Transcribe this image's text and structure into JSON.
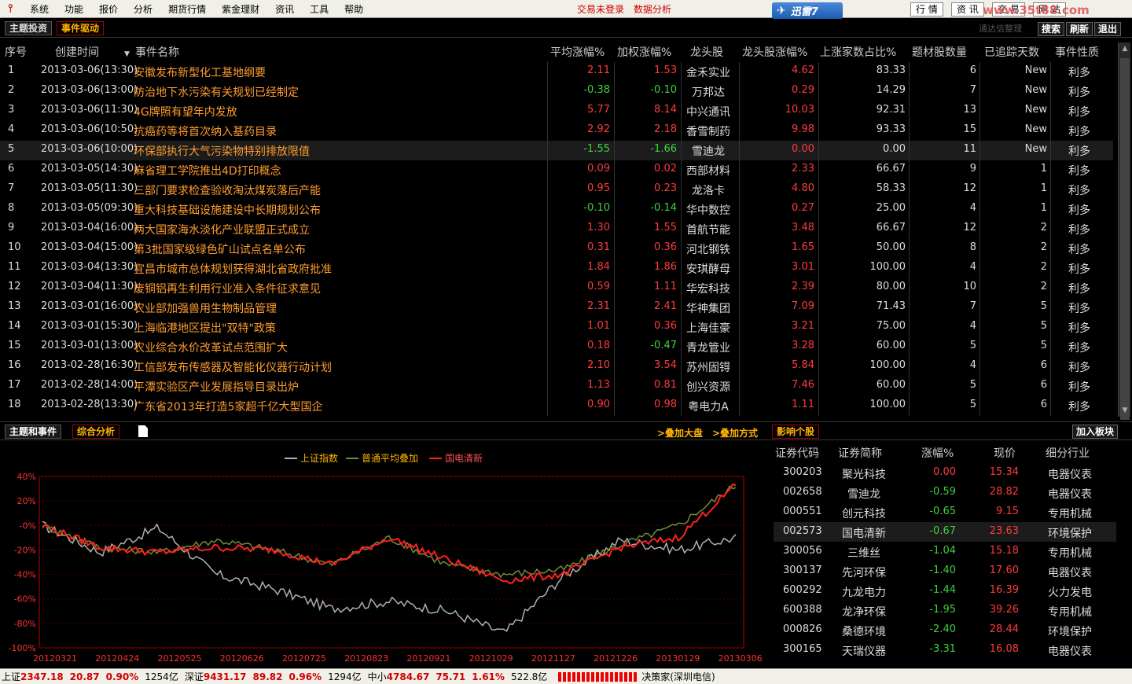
{
  "menu": {
    "items": [
      "系统",
      "功能",
      "报价",
      "分析",
      "期货行情",
      "紫金理财",
      "资讯",
      "工具",
      "帮助"
    ],
    "trade_status": "交易未登录",
    "data_analysis": "数据分析",
    "xunlei": "迅雷7",
    "right_tabs": [
      "行 情",
      "资 讯",
      "交 易",
      "网 站"
    ],
    "watermark": "www.35t88.com",
    "watermark_sub": "通达信整理"
  },
  "toolbar1": {
    "tab_theme": "主题投资",
    "tab_event": "事件驱动",
    "search": "搜索",
    "refresh": "刷新",
    "exit": "退出"
  },
  "events": {
    "headers": [
      "序号",
      "创建时间",
      "事件名称",
      "平均涨幅%",
      "加权涨幅%",
      "龙头股",
      "龙头股涨幅%",
      "上涨家数占比%",
      "题材股数量",
      "已追踪天数",
      "事件性质"
    ],
    "sort_indicator": "▼",
    "rows": [
      {
        "idx": "1",
        "time": "2013-03-06(13:30)",
        "name": "安徽发布新型化工基地纲要",
        "avg": "2.11",
        "wt": "1.53",
        "lead": "金禾实业",
        "leadchg": "4.62",
        "uppct": "83.33",
        "cnt": "6",
        "days": "New",
        "nature": "利多"
      },
      {
        "idx": "2",
        "time": "2013-03-06(13:00)",
        "name": "防治地下水污染有关规划已经制定",
        "avg": "-0.38",
        "wt": "-0.10",
        "lead": "万邦达",
        "leadchg": "0.29",
        "uppct": "14.29",
        "cnt": "7",
        "days": "New",
        "nature": "利多"
      },
      {
        "idx": "3",
        "time": "2013-03-06(11:30)",
        "name": "4G牌照有望年内发放",
        "avg": "5.77",
        "wt": "8.14",
        "lead": "中兴通讯",
        "leadchg": "10.03",
        "uppct": "92.31",
        "cnt": "13",
        "days": "New",
        "nature": "利多"
      },
      {
        "idx": "4",
        "time": "2013-03-06(10:50)",
        "name": "抗癌药等将首次纳入基药目录",
        "avg": "2.92",
        "wt": "2.18",
        "lead": "香雪制药",
        "leadchg": "9.98",
        "uppct": "93.33",
        "cnt": "15",
        "days": "New",
        "nature": "利多"
      },
      {
        "idx": "5",
        "time": "2013-03-06(10:00)",
        "name": "环保部执行大气污染物特别排放限值",
        "avg": "-1.55",
        "wt": "-1.66",
        "lead": "雪迪龙",
        "leadchg": "0.00",
        "uppct": "0.00",
        "cnt": "11",
        "days": "New",
        "nature": "利多"
      },
      {
        "idx": "6",
        "time": "2013-03-05(14:30)",
        "name": "麻省理工学院推出4D打印概念",
        "avg": "0.09",
        "wt": "0.02",
        "lead": "西部材料",
        "leadchg": "2.33",
        "uppct": "66.67",
        "cnt": "9",
        "days": "1",
        "nature": "利多"
      },
      {
        "idx": "7",
        "time": "2013-03-05(11:30)",
        "name": "三部门要求检查验收淘汰煤炭落后产能",
        "avg": "0.95",
        "wt": "0.23",
        "lead": "龙洛卡",
        "leadchg": "4.80",
        "uppct": "58.33",
        "cnt": "12",
        "days": "1",
        "nature": "利多"
      },
      {
        "idx": "8",
        "time": "2013-03-05(09:30)",
        "name": "重大科技基础设施建设中长期规划公布",
        "avg": "-0.10",
        "wt": "-0.14",
        "lead": "华中数控",
        "leadchg": "0.27",
        "uppct": "25.00",
        "cnt": "4",
        "days": "1",
        "nature": "利多"
      },
      {
        "idx": "9",
        "time": "2013-03-04(16:00)",
        "name": "两大国家海水淡化产业联盟正式成立",
        "avg": "1.30",
        "wt": "1.55",
        "lead": "首航节能",
        "leadchg": "3.48",
        "uppct": "66.67",
        "cnt": "12",
        "days": "2",
        "nature": "利多"
      },
      {
        "idx": "10",
        "time": "2013-03-04(15:00)",
        "name": "第3批国家级绿色矿山试点名单公布",
        "avg": "0.31",
        "wt": "0.36",
        "lead": "河北钢铁",
        "leadchg": "1.65",
        "uppct": "50.00",
        "cnt": "8",
        "days": "2",
        "nature": "利多"
      },
      {
        "idx": "11",
        "time": "2013-03-04(13:30)",
        "name": "宜昌市城市总体规划获得湖北省政府批准",
        "avg": "1.84",
        "wt": "1.86",
        "lead": "安琪酵母",
        "leadchg": "3.01",
        "uppct": "100.00",
        "cnt": "4",
        "days": "2",
        "nature": "利多"
      },
      {
        "idx": "12",
        "time": "2013-03-04(11:30)",
        "name": "废铜铝再生利用行业准入条件征求意见",
        "avg": "0.59",
        "wt": "1.11",
        "lead": "华宏科技",
        "leadchg": "2.39",
        "uppct": "80.00",
        "cnt": "10",
        "days": "2",
        "nature": "利多"
      },
      {
        "idx": "13",
        "time": "2013-03-01(16:00)",
        "name": "农业部加强兽用生物制品管理",
        "avg": "2.31",
        "wt": "2.41",
        "lead": "华神集团",
        "leadchg": "7.09",
        "uppct": "71.43",
        "cnt": "7",
        "days": "5",
        "nature": "利多"
      },
      {
        "idx": "14",
        "time": "2013-03-01(15:30)",
        "name": "上海临港地区提出\"双特\"政策",
        "avg": "1.01",
        "wt": "0.36",
        "lead": "上海佳豪",
        "leadchg": "3.21",
        "uppct": "75.00",
        "cnt": "4",
        "days": "5",
        "nature": "利多"
      },
      {
        "idx": "15",
        "time": "2013-03-01(13:00)",
        "name": "农业综合水价改革试点范围扩大",
        "avg": "0.18",
        "wt": "-0.47",
        "lead": "青龙管业",
        "leadchg": "3.28",
        "uppct": "60.00",
        "cnt": "5",
        "days": "5",
        "nature": "利多"
      },
      {
        "idx": "16",
        "time": "2013-02-28(16:30)",
        "name": "工信部发布传感器及智能化仪器行动计划",
        "avg": "2.10",
        "wt": "3.54",
        "lead": "苏州固锝",
        "leadchg": "5.84",
        "uppct": "100.00",
        "cnt": "4",
        "days": "6",
        "nature": "利多"
      },
      {
        "idx": "17",
        "time": "2013-02-28(14:00)",
        "name": "平潭实验区产业发展指导目录出炉",
        "avg": "1.13",
        "wt": "0.81",
        "lead": "创兴资源",
        "leadchg": "7.46",
        "uppct": "60.00",
        "cnt": "5",
        "days": "6",
        "nature": "利多"
      },
      {
        "idx": "18",
        "time": "2013-02-28(13:30)",
        "name": "广东省2013年打造5家超千亿大型国企",
        "avg": "0.90",
        "wt": "0.98",
        "lead": "粤电力A",
        "leadchg": "1.11",
        "uppct": "100.00",
        "cnt": "5",
        "days": "6",
        "nature": "利多"
      }
    ]
  },
  "toolbar2": {
    "tab_theme_event": "主题和事件",
    "tab_analysis": "综合分析",
    "overlay_market": ">叠加大盘",
    "overlay_mode": ">叠加方式",
    "impact_stocks": "影响个股",
    "add_block": "加入板块"
  },
  "chart_data": {
    "type": "line",
    "title": "",
    "legend": [
      "上证指数",
      "普通平均叠加",
      "国电清新"
    ],
    "colors": {
      "上证指数": "#b0b0b0",
      "普通平均叠加": "#6b8f3a",
      "国电清新": "#ff2020"
    },
    "x": [
      "20120321",
      "20120424",
      "20120525",
      "20120626",
      "20120725",
      "20120823",
      "20120921",
      "20121029",
      "20121127",
      "20121226",
      "20130129",
      "20130306"
    ],
    "ylim": [
      -100,
      40
    ],
    "yticks": [
      "40%",
      "20%",
      "-0%",
      "-20%",
      "-40%",
      "-60%",
      "-80%",
      "-100%"
    ],
    "ytick_values": [
      40,
      20,
      0,
      -20,
      -40,
      -60,
      -80,
      -100
    ],
    "series": [
      {
        "name": "上证指数",
        "values": [
          0,
          -22,
          -2,
          -40,
          -52,
          -68,
          -62,
          -70,
          -88,
          -42,
          -12,
          -20,
          -10
        ]
      },
      {
        "name": "普通平均叠加",
        "values": [
          0,
          -18,
          -22,
          -12,
          -20,
          -32,
          -10,
          -32,
          -40,
          -36,
          -16,
          0,
          33
        ]
      },
      {
        "name": "国电清新",
        "values": [
          0,
          -18,
          -22,
          -18,
          -20,
          -32,
          -10,
          -28,
          -45,
          -40,
          -18,
          -10,
          33
        ]
      }
    ]
  },
  "stocks": {
    "headers": [
      "证券代码",
      "证券简称",
      "涨幅%",
      "现价",
      "细分行业"
    ],
    "rows": [
      {
        "code": "300203",
        "name": "聚光科技",
        "chg": "0.00",
        "price": "15.34",
        "ind": "电器仪表"
      },
      {
        "code": "002658",
        "name": "雪迪龙",
        "chg": "-0.59",
        "price": "28.82",
        "ind": "电器仪表"
      },
      {
        "code": "000551",
        "name": "创元科技",
        "chg": "-0.65",
        "price": "9.15",
        "ind": "专用机械"
      },
      {
        "code": "002573",
        "name": "国电清新",
        "chg": "-0.67",
        "price": "23.63",
        "ind": "环境保护"
      },
      {
        "code": "300056",
        "name": "三维丝",
        "chg": "-1.04",
        "price": "15.18",
        "ind": "专用机械"
      },
      {
        "code": "300137",
        "name": "先河环保",
        "chg": "-1.40",
        "price": "17.60",
        "ind": "电器仪表"
      },
      {
        "code": "600292",
        "name": "九龙电力",
        "chg": "-1.44",
        "price": "16.39",
        "ind": "火力发电"
      },
      {
        "code": "600388",
        "name": "龙净环保",
        "chg": "-1.95",
        "price": "39.26",
        "ind": "专用机械"
      },
      {
        "code": "000826",
        "name": "桑德环境",
        "chg": "-2.40",
        "price": "28.44",
        "ind": "环境保护"
      },
      {
        "code": "300165",
        "name": "天瑞仪器",
        "chg": "-3.31",
        "price": "16.08",
        "ind": "电器仪表"
      }
    ]
  },
  "status": {
    "sh_label": "上证",
    "sh_val": "2347.18",
    "sh_chg": "20.87",
    "sh_pct": "0.90%",
    "sh_amt": "1254亿",
    "sz_label": "深证",
    "sz_val": "9431.17",
    "sz_chg": "89.82",
    "sz_pct": "0.96%",
    "sz_amt": "1294亿",
    "zx_label": "中小",
    "zx_val": "4784.67",
    "zx_chg": "75.71",
    "zx_pct": "1.61%",
    "zx_amt": "522.8亿",
    "broker": "决策家(深圳电信)"
  }
}
